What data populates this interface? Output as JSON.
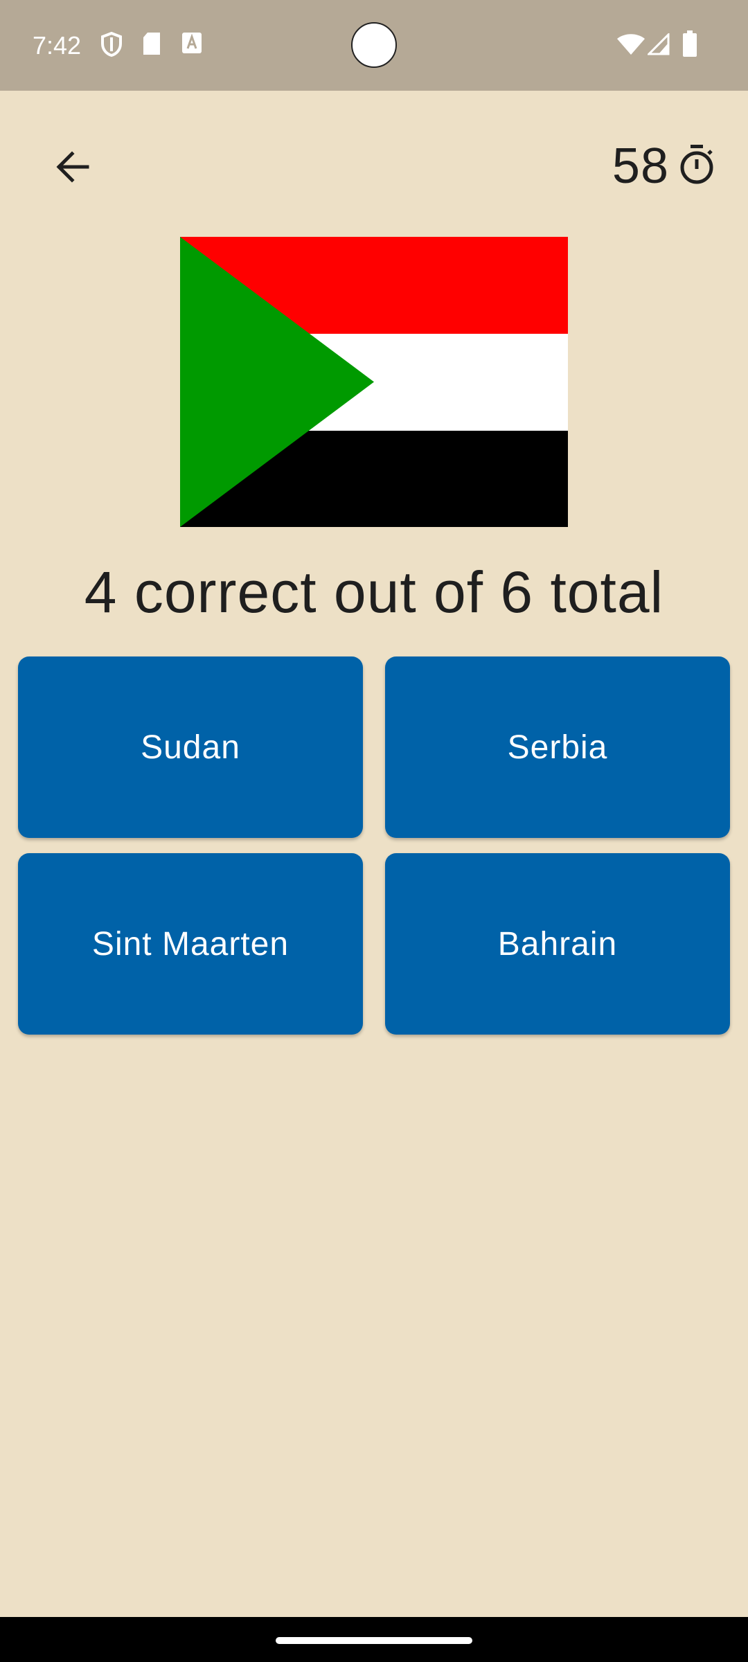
{
  "status_bar": {
    "time": "7:42",
    "icons": [
      "shield-icon",
      "sd-card-icon",
      "text-a-icon",
      "wifi-icon",
      "signal-icon",
      "battery-icon"
    ],
    "background": "#B5A996"
  },
  "header": {
    "back_icon": "arrow-back-icon",
    "timer_value": "58",
    "timer_icon": "stopwatch-icon"
  },
  "flag": {
    "colors": {
      "top": "#FF0000",
      "middle": "#FFFFFF",
      "bottom": "#000000",
      "triangle": "#009A00"
    }
  },
  "score": {
    "text": "4 correct out of 6 total"
  },
  "answers": [
    {
      "label": "Sudan"
    },
    {
      "label": "Serbia"
    },
    {
      "label": "Sint Maarten"
    },
    {
      "label": "Bahrain"
    }
  ],
  "colors": {
    "background": "#EDE0C6",
    "button": "#0062A8",
    "button_text": "#FFFFFF"
  }
}
